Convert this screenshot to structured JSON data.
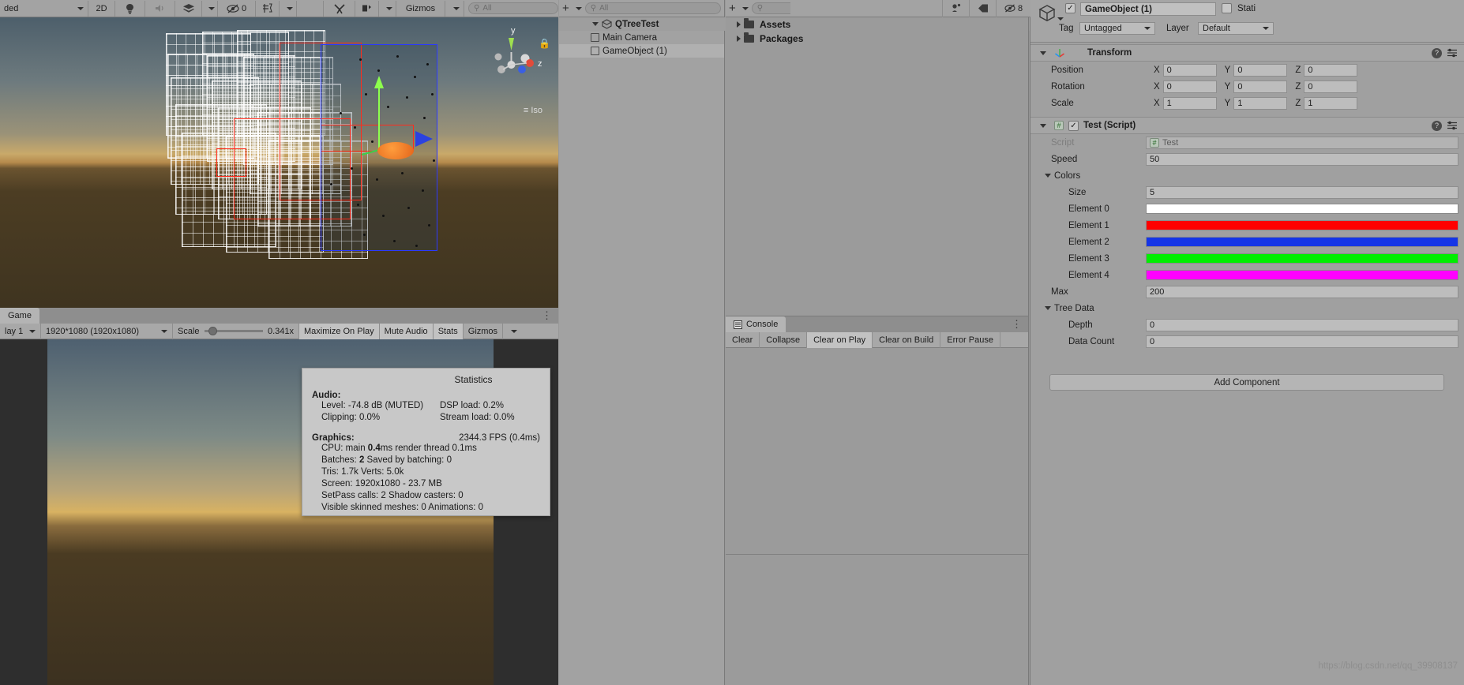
{
  "scene": {
    "toolbar": [
      {
        "label": "ded",
        "icon": "shading-mode-dropdown",
        "caret": true
      },
      {
        "label": "2D",
        "icon": "toggle-2d",
        "caret": false
      },
      {
        "label": "",
        "icon": "lighting-icon",
        "caret": false
      },
      {
        "label": "",
        "icon": "audio-icon",
        "caret": false
      },
      {
        "label": "",
        "icon": "fx-layers-icon",
        "caret": true
      },
      {
        "label": "0",
        "icon": "scene-visibility-icon",
        "caret": false
      },
      {
        "label": "",
        "icon": "camera-settings-icon",
        "caret": true
      },
      {
        "label": "",
        "icon": "tools-icon",
        "caret": false
      },
      {
        "label": "",
        "icon": "grid-snap-icon",
        "caret": true
      },
      {
        "label": "Gizmos",
        "icon": "gizmos-icon",
        "caret": true
      }
    ],
    "search_placeholder": "All",
    "gizmo_axes": {
      "y": "y",
      "z": "z"
    },
    "view_mode": "Iso",
    "lock_icon": "lock-icon"
  },
  "game": {
    "tab_label": "Game",
    "display_label": "lay 1",
    "resolution": "1920*1080 (1920x1080)",
    "scale_label": "Scale",
    "scale_value": "0.341x",
    "buttons": [
      "Maximize On Play",
      "Mute Audio",
      "Stats",
      "Gizmos"
    ],
    "options_icon": "kebab-menu-icon"
  },
  "statistics": {
    "title": "Statistics",
    "audio_header": "Audio:",
    "audio": [
      {
        "left": "Level: -74.8 dB (MUTED)",
        "right": "DSP load: 0.2%"
      },
      {
        "left": "Clipping: 0.0%",
        "right": "Stream load: 0.0%"
      }
    ],
    "graphics_header": "Graphics:",
    "fps": "2344.3 FPS (0.4ms)",
    "lines": [
      {
        "pre": "CPU: main ",
        "b": "0.4",
        "post": "ms  render thread 0.1ms"
      },
      {
        "pre": "Batches: ",
        "b": "2",
        "post": "      Saved by batching: 0"
      },
      {
        "pre": "Tris: 1.7k         Verts: 5.0k",
        "b": "",
        "post": ""
      },
      {
        "pre": "Screen: 1920x1080 - 23.7 MB",
        "b": "",
        "post": ""
      },
      {
        "pre": "SetPass calls: 2          Shadow casters: 0",
        "b": "",
        "post": ""
      },
      {
        "pre": "Visible skinned meshes: 0  Animations: 0",
        "b": "",
        "post": ""
      }
    ]
  },
  "hierarchy": {
    "add_label": "+",
    "search_placeholder": "All",
    "items": [
      {
        "label": "QTreeTest",
        "indent": 0,
        "expanded": true,
        "selected": false,
        "icon": "scene-icon",
        "kebab": true
      },
      {
        "label": "Main Camera",
        "indent": 1,
        "expanded": false,
        "selected": false,
        "icon": "gameobject-icon",
        "kebab": false
      },
      {
        "label": "GameObject (1)",
        "indent": 1,
        "expanded": false,
        "selected": true,
        "icon": "gameobject-icon",
        "kebab": false
      }
    ]
  },
  "project": {
    "add_label": "+",
    "search_placeholder": "",
    "items": [
      {
        "label": "Assets",
        "icon": "folder-icon"
      },
      {
        "label": "Packages",
        "icon": "folder-icon"
      }
    ]
  },
  "console": {
    "tab_label": "Console",
    "tab_icon": "console-icon",
    "options_icon": "kebab-menu-icon",
    "buttons": [
      {
        "label": "Clear",
        "active": false
      },
      {
        "label": "Collapse",
        "active": false
      },
      {
        "label": "Clear on Play",
        "active": true
      },
      {
        "label": "Clear on Build",
        "active": false
      },
      {
        "label": "Error Pause",
        "active": false
      }
    ]
  },
  "inspector": {
    "toolbar_icons": [
      "lock-icon",
      "tag-icon",
      "visibility-icon"
    ],
    "visibility_count": "8",
    "object_icon": "gameobject-icon",
    "enabled_check": "✓",
    "object_name": "GameObject (1)",
    "static_label": "Stati",
    "static_checked": false,
    "tag_label": "Tag",
    "tag_value": "Untagged",
    "layer_label": "Layer",
    "layer_value": "Default",
    "transform": {
      "title": "Transform",
      "icon": "transform-icon",
      "rows": [
        {
          "label": "Position",
          "x": "0",
          "y": "0",
          "z": "0"
        },
        {
          "label": "Rotation",
          "x": "0",
          "y": "0",
          "z": "0"
        },
        {
          "label": "Scale",
          "x": "1",
          "y": "1",
          "z": "1"
        }
      ]
    },
    "test_script": {
      "title": "Test (Script)",
      "icon": "cs-script-icon",
      "enabled": true,
      "script_label": "Script",
      "script_value": "Test",
      "speed_label": "Speed",
      "speed_value": "50",
      "colors_label": "Colors",
      "size_label": "Size",
      "size_value": "5",
      "elements": [
        {
          "label": "Element 0",
          "color": "#ffffff"
        },
        {
          "label": "Element 1",
          "color": "#ff0000"
        },
        {
          "label": "Element 2",
          "color": "#1535e6"
        },
        {
          "label": "Element 3",
          "color": "#00ef00"
        },
        {
          "label": "Element 4",
          "color": "#ff00ff"
        }
      ],
      "max_label": "Max",
      "max_value": "200",
      "tree_data_label": "Tree Data",
      "depth_label": "Depth",
      "depth_value": "0",
      "data_count_label": "Data Count",
      "data_count_value": "0"
    },
    "add_component_label": "Add Component"
  },
  "watermark": "https://blog.csdn.net/qq_39908137",
  "colors": {
    "panel": "#a0a0a0",
    "toolbar": "#a3a3a3",
    "selection": "#b0b0b0",
    "field": "#bdbdbd"
  }
}
